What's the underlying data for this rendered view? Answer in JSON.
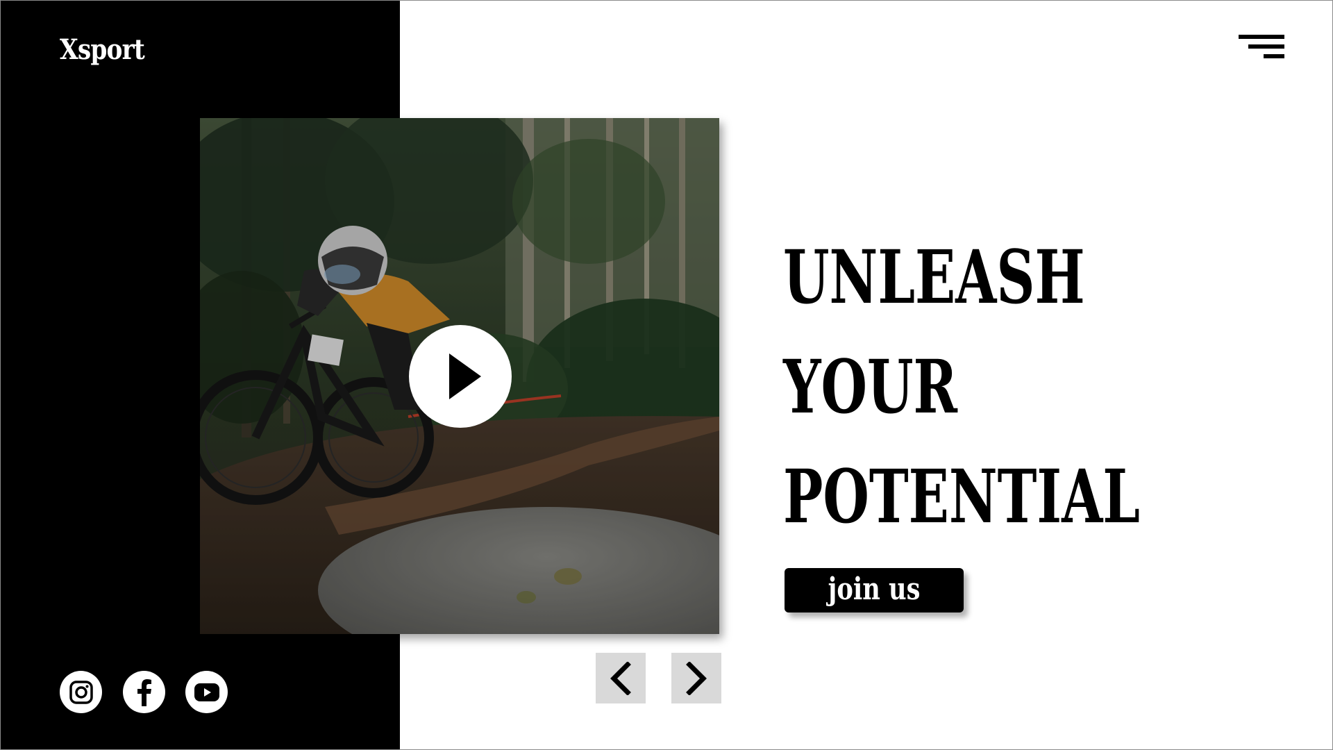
{
  "brand": {
    "logo_text": "Xsport"
  },
  "header": {
    "menu_icon": "hamburger-menu-icon"
  },
  "hero": {
    "image_description_icon": "mountain-biker-photo",
    "play_icon": "play-icon"
  },
  "headline": {
    "lines": [
      "UNLEASH",
      "YOUR",
      "POTENTIAL"
    ]
  },
  "cta": {
    "label": "join us"
  },
  "carousel": {
    "prev_icon": "chevron-left-icon",
    "next_icon": "chevron-right-icon"
  },
  "social": [
    {
      "name": "instagram",
      "icon": "instagram-icon"
    },
    {
      "name": "facebook",
      "icon": "facebook-icon"
    },
    {
      "name": "youtube",
      "icon": "youtube-icon"
    }
  ],
  "colors": {
    "background": "#ffffff",
    "panel": "#000000",
    "nav_button": "#d9d9d9",
    "text_dark": "#000000",
    "text_light": "#ffffff"
  }
}
